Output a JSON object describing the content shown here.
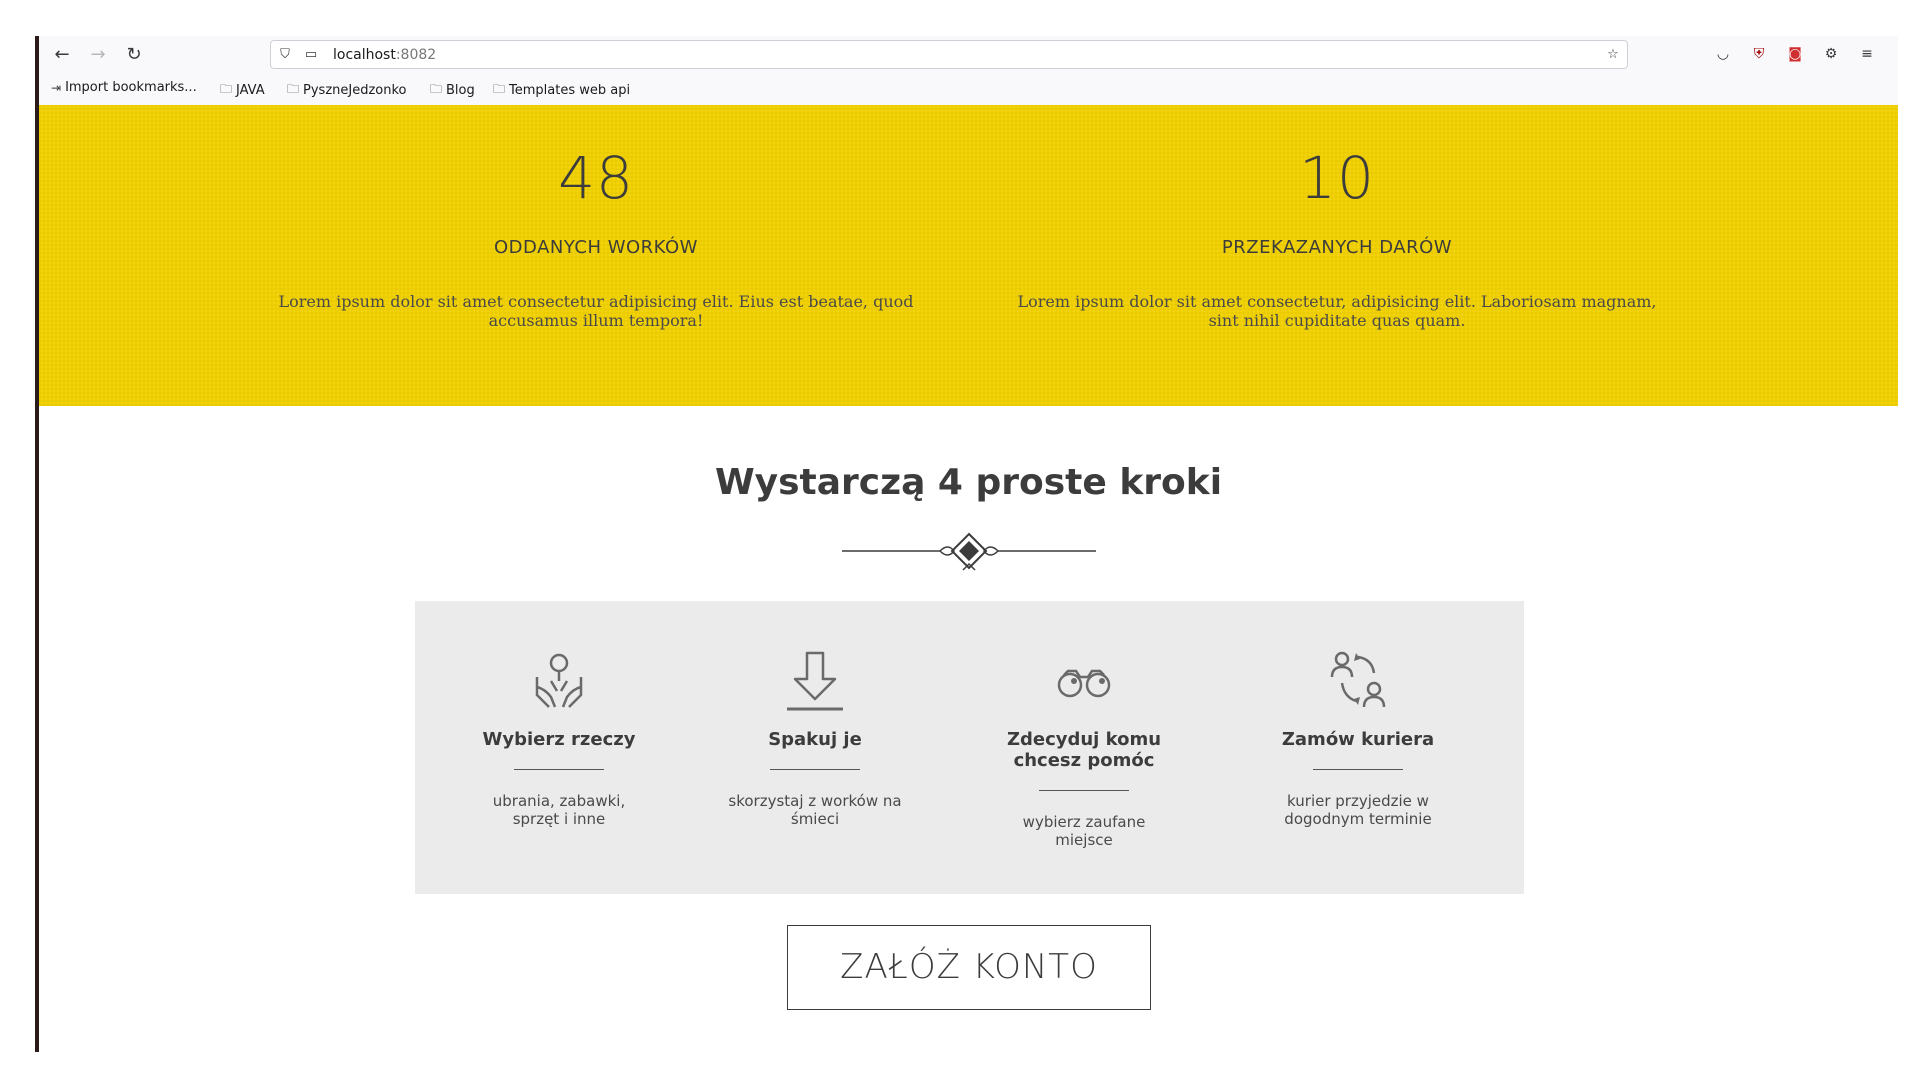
{
  "browser": {
    "url_host": "localhost",
    "url_port": ":8082",
    "bookmarks": [
      {
        "label": "Import bookmarks...",
        "icon": "import-icon"
      },
      {
        "label": "JAVA",
        "icon": "folder-icon"
      },
      {
        "label": "PyszneJedzonko",
        "icon": "folder-icon"
      },
      {
        "label": "Blog",
        "icon": "folder-icon"
      },
      {
        "label": "Templates web api",
        "icon": "folder-icon"
      }
    ]
  },
  "stats": [
    {
      "number": "48",
      "label": "ODDANYCH WORKÓW",
      "description": "Lorem ipsum dolor sit amet consectetur adipisicing elit. Eius est beatae, quod accusamus illum tempora!"
    },
    {
      "number": "10",
      "label": "PRZEKAZANYCH DARÓW",
      "description": "Lorem ipsum dolor sit amet consectetur, adipisicing elit. Laboriosam magnam, sint nihil cupiditate quas quam."
    }
  ],
  "steps_section": {
    "title": "Wystarczą 4 proste kroki",
    "steps": [
      {
        "icon": "hands-heart-icon",
        "title": "Wybierz rzeczy",
        "description": "ubrania, zabawki, sprzęt i inne"
      },
      {
        "icon": "download-arrow-icon",
        "title": "Spakuj je",
        "description": "skorzystaj z worków na śmieci"
      },
      {
        "icon": "binoculars-icon",
        "title": "Zdecyduj komu chcesz pomóc",
        "description": "wybierz zaufane miejsce"
      },
      {
        "icon": "courier-exchange-icon",
        "title": "Zamów kuriera",
        "description": "kurier przyjedzie w dogodnym terminie"
      }
    ]
  },
  "cta": {
    "label": "ZAŁÓŻ KONTO"
  },
  "colors": {
    "accent_yellow": "#f3d200",
    "text_dark": "#3c3c3c",
    "steps_background": "#ebebeb"
  }
}
